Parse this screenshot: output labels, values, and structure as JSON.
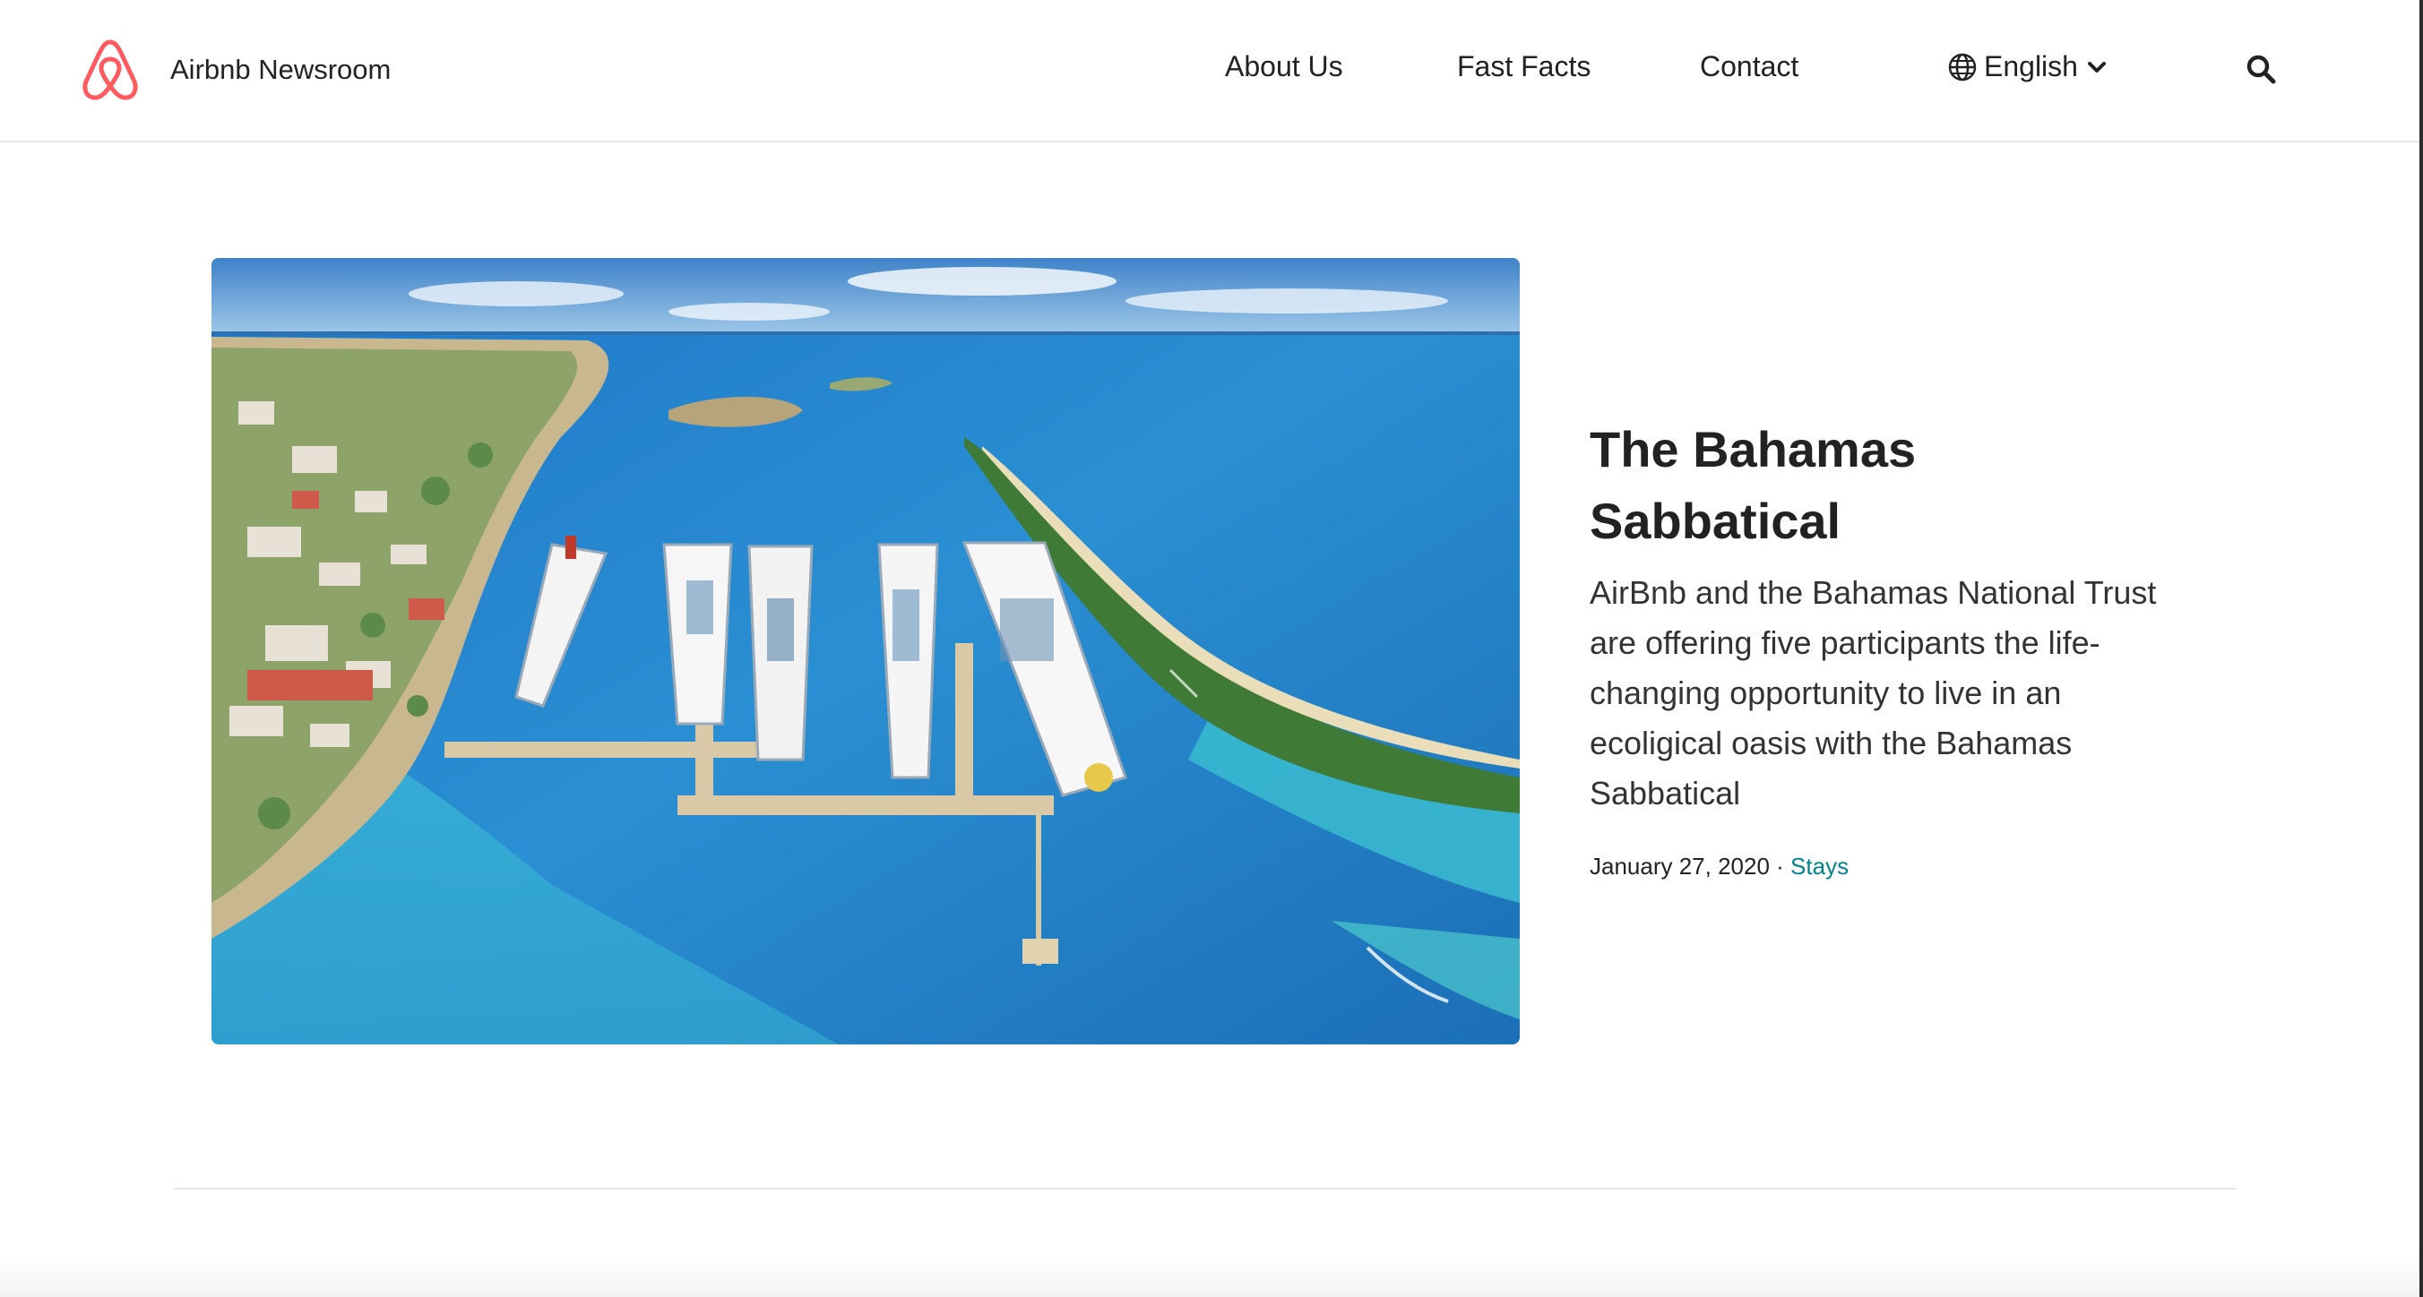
{
  "header": {
    "brand_name": "Airbnb Newsroom",
    "nav": [
      "About Us",
      "Fast Facts",
      "Contact"
    ],
    "language": {
      "selected": "English",
      "icon": "globe-icon"
    },
    "search_icon": "search-icon",
    "brand_color": "#FF5A5F"
  },
  "story": {
    "title": "The Bahamas Sabbatical",
    "summary": "AirBnb and the Bahamas National Trust are offering five participants the life-changing opportunity to live in an ecoligical oasis with the Bahamas Sabbatical",
    "date": "January 27, 2020",
    "separator": " · ",
    "category": "Stays",
    "category_color": "#008489"
  }
}
